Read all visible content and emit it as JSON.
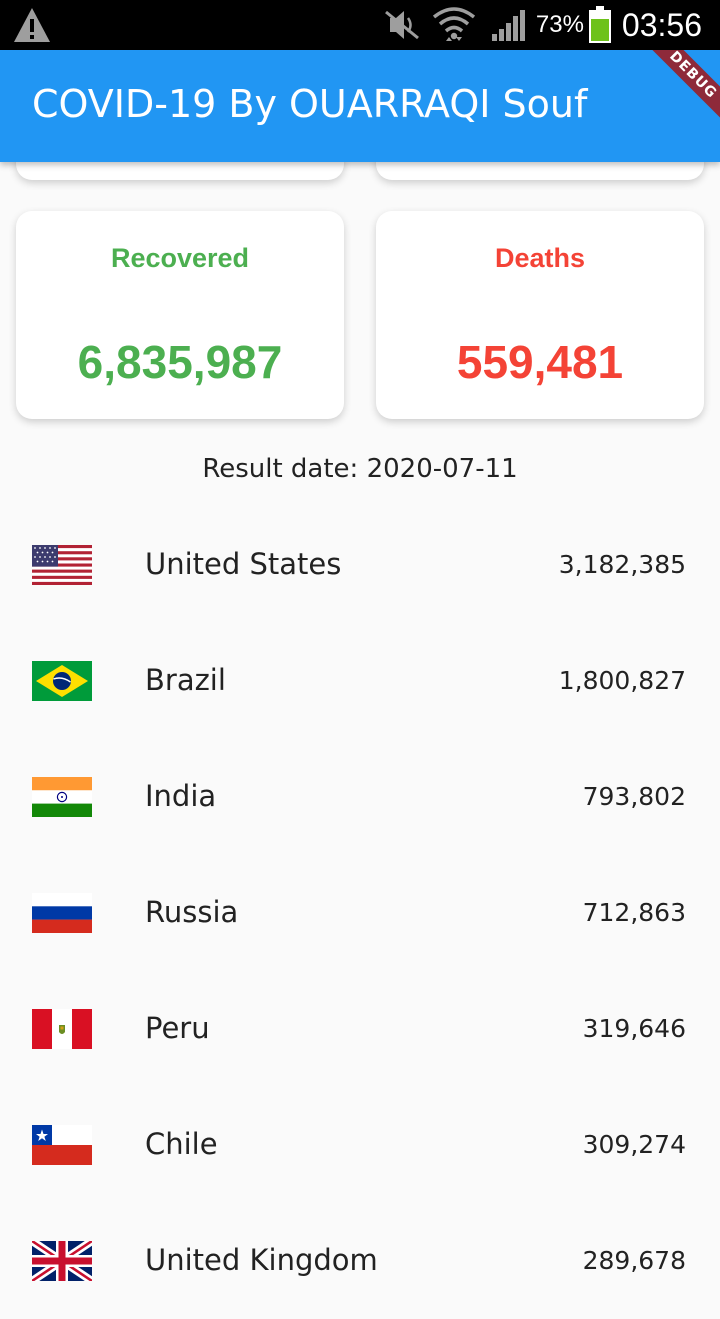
{
  "status_bar": {
    "battery_percent": "73%",
    "time": "03:56",
    "icons": [
      "warning-icon",
      "mute-icon",
      "wifi-icon",
      "signal-icon",
      "battery-icon"
    ]
  },
  "app_bar": {
    "title": "COVID-19 By OUARRAQI Souf",
    "debug_banner": "DEBUG",
    "color": "#2196f3"
  },
  "cards": {
    "recovered": {
      "label": "Recovered",
      "value": "6,835,987",
      "color": "#4caf50"
    },
    "deaths": {
      "label": "Deaths",
      "value": "559,481",
      "color": "#f44336"
    }
  },
  "result_date": "Result date: 2020-07-11",
  "countries": [
    {
      "name": "United States",
      "count": "3,182,385",
      "flag": "us-flag-icon"
    },
    {
      "name": "Brazil",
      "count": "1,800,827",
      "flag": "brazil-flag-icon"
    },
    {
      "name": "India",
      "count": "793,802",
      "flag": "india-flag-icon"
    },
    {
      "name": "Russia",
      "count": "712,863",
      "flag": "russia-flag-icon"
    },
    {
      "name": "Peru",
      "count": "319,646",
      "flag": "peru-flag-icon"
    },
    {
      "name": "Chile",
      "count": "309,274",
      "flag": "chile-flag-icon"
    },
    {
      "name": "United Kingdom",
      "count": "289,678",
      "flag": "uk-flag-icon"
    }
  ]
}
